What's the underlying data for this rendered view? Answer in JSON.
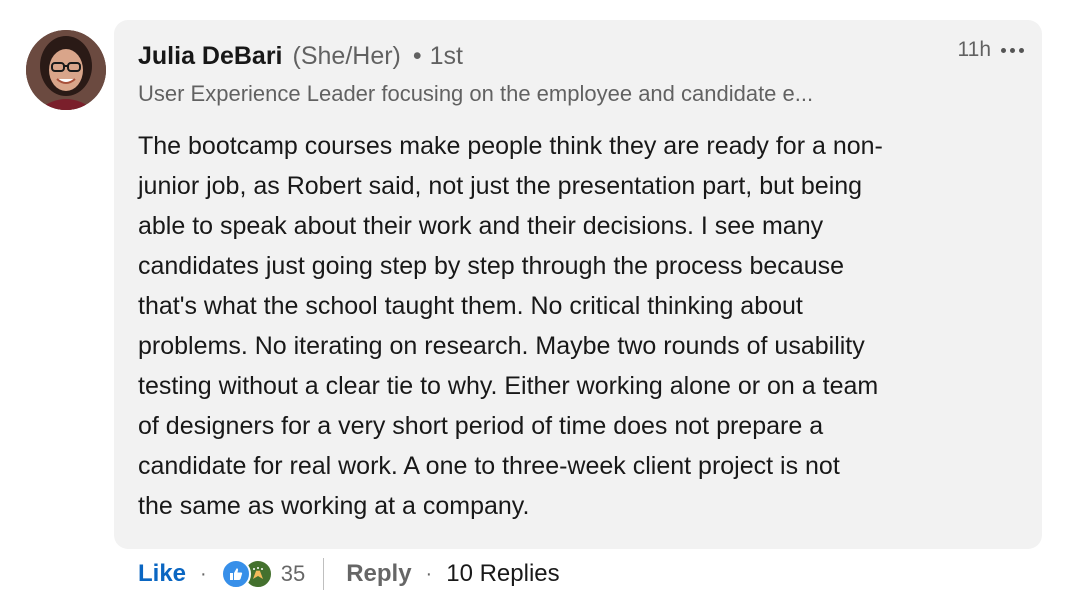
{
  "comment": {
    "author": {
      "name": "Julia DeBari",
      "pronouns": "(She/Her)",
      "separator": "•",
      "degree": "1st",
      "headline": "User Experience Leader focusing on the employee and candidate e..."
    },
    "timestamp": "11h",
    "more_icon": "ellipsis-icon",
    "body_lines": [
      "The bootcamp courses make people think they are ready for a non-",
      "junior job, as Robert said, not just the presentation part, but being",
      "able to speak about their work and their decisions. I see many",
      "candidates just going step by step through the process because",
      "that's what the school taught them. No critical thinking about",
      "problems. No iterating on research. Maybe two rounds of usability",
      "testing without a clear tie to why. Either working alone or on a team",
      "of designers for a very short period of time does not prepare a",
      "candidate for real work. A one to three-week client project is not",
      "the same as working at a company."
    ]
  },
  "actions": {
    "like_label": "Like",
    "dot": "·",
    "reaction_icons": [
      "like-reaction-icon",
      "celebrate-reaction-icon"
    ],
    "reaction_count": "35",
    "reply_label": "Reply",
    "replies_label": "10 Replies"
  },
  "colors": {
    "like_blue": "#0a66c2",
    "bubble_bg": "#f2f2f2",
    "like_reaction": "#378fe9",
    "celebrate_reaction": "#44712e"
  }
}
